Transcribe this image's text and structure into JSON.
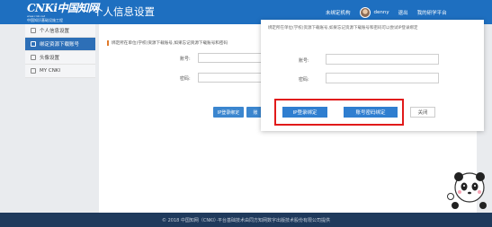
{
  "header": {
    "logo_text": "CNKi中国知网",
    "logo_url": "www.cnki.net",
    "logo_tagline": "中国知识基础设施工程",
    "page_title": "个人信息设置",
    "nav": {
      "bind_org": "未绑定机构",
      "username": "denny",
      "logout": "退出",
      "platform": "我的研学平台"
    }
  },
  "sidebar": {
    "items": [
      {
        "label": "个人信息设置"
      },
      {
        "label": "绑定资源下载账号"
      },
      {
        "label": "头像设置"
      },
      {
        "label": "MY CNKI"
      }
    ]
  },
  "main": {
    "notice": "绑定所在单位(学校)资源下载账号,如果忘记资源下载账号和密码",
    "account_label": "账号:",
    "password_label": "密码:",
    "ip_bind_button": "IP登录绑定",
    "account_bind_button": "账"
  },
  "modal": {
    "message": "绑定所在单位(学校)资源下载账号,如果忘记资源下载账号和密码可以尝试IP登录绑定",
    "account_label": "账号:",
    "password_label": "密码:",
    "ip_bind_button": "IP登录绑定",
    "account_bind_button": "账号密码绑定",
    "close_button": "关闭"
  },
  "footer": {
    "text": "© 2018 中国知网（CNKI）·平台基础技术由同方知网数字出版技术股份有限公司提供"
  },
  "colors": {
    "header": "#1e6fc0",
    "active": "#2d6fb7",
    "button": "#2f7ed0",
    "highlight": "#e11a1a",
    "footer": "#1f3a5c"
  }
}
